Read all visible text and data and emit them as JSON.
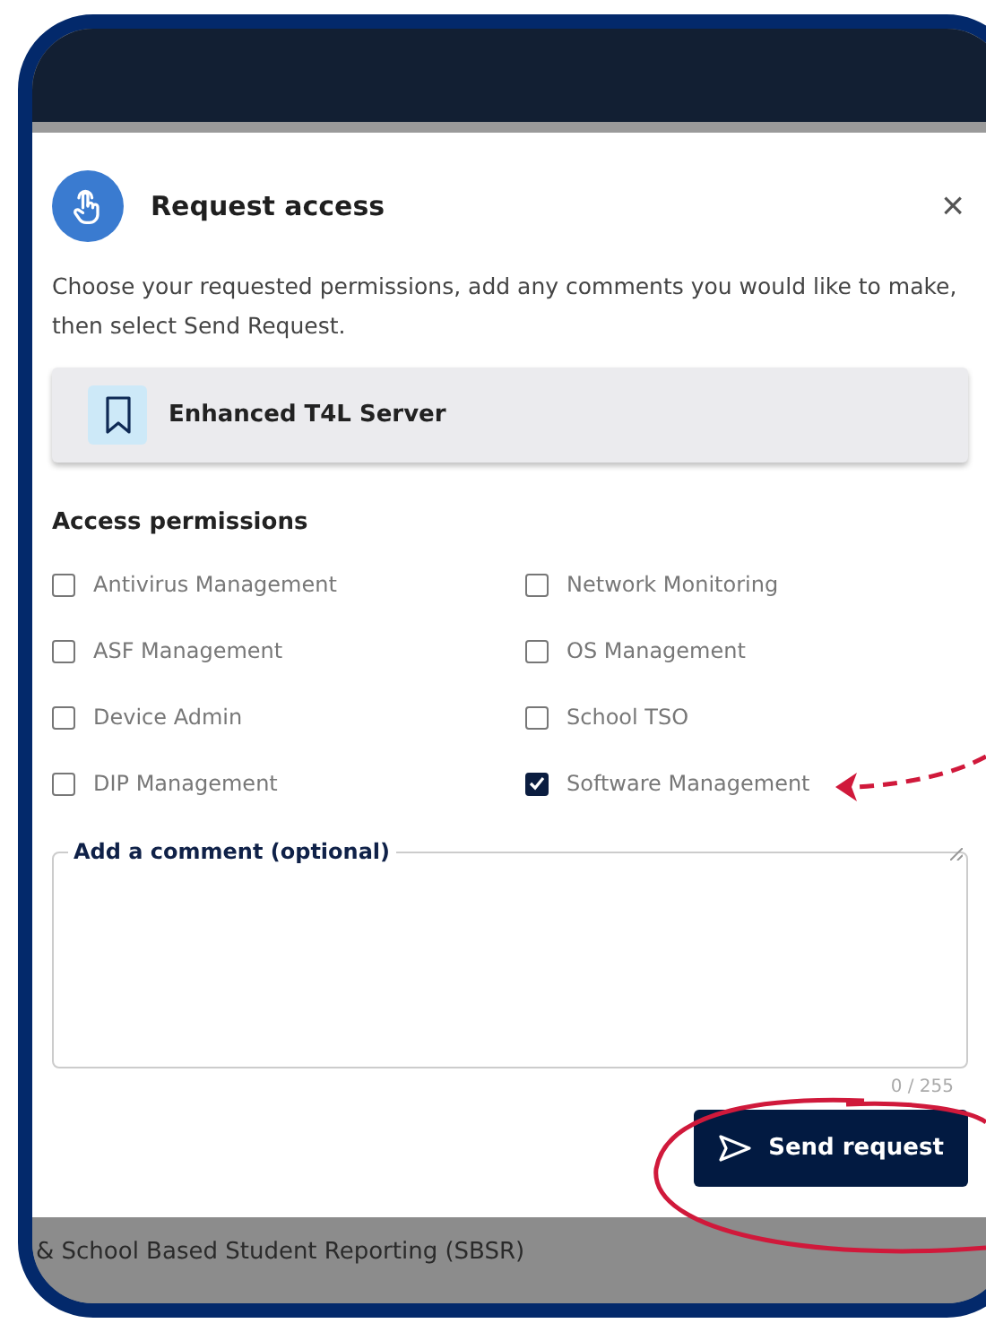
{
  "dialog": {
    "title": "Request access",
    "close": "×",
    "description": "Choose your requested permissions, add any comments you would like to make, then select Send Request.",
    "resource": {
      "name": "Enhanced T4L Server"
    },
    "permissions_heading": "Access permissions",
    "permissions": [
      {
        "label": "Antivirus Management",
        "checked": false
      },
      {
        "label": "Network Monitoring",
        "checked": false
      },
      {
        "label": "ASF Management",
        "checked": false
      },
      {
        "label": "OS Management",
        "checked": false
      },
      {
        "label": "Device Admin",
        "checked": false
      },
      {
        "label": "School TSO",
        "checked": false
      },
      {
        "label": "DIP Management",
        "checked": false
      },
      {
        "label": "Software Management",
        "checked": true
      }
    ],
    "comment": {
      "label": "Add a comment (optional)",
      "counter": "0 / 255"
    },
    "submit": "Send request"
  },
  "background_text": "& School Based Student Reporting (SBSR)"
}
